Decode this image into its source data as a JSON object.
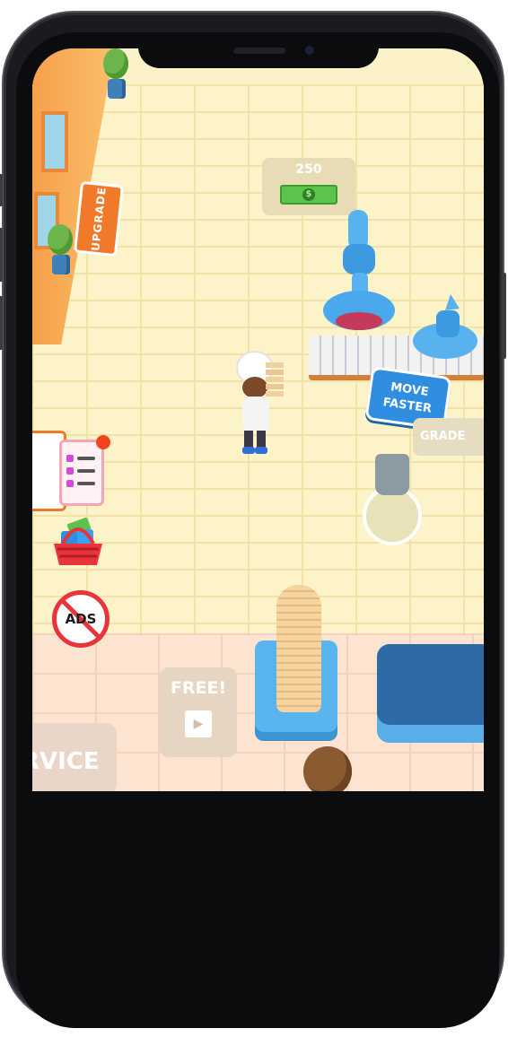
{
  "game": {
    "price_tag": {
      "amount": "250",
      "currency_icon": "dollar-bill-icon"
    },
    "upgrade_sign": "UPGRADE",
    "move_faster_badge": {
      "line1": "MOVE",
      "line2": "FASTER"
    },
    "upgrade_tag_partial": "GRADE",
    "free_tile": {
      "label": "FREE!",
      "icon": "video-ad-icon"
    },
    "service_tile": {
      "label": "RVICE"
    },
    "no_ads": {
      "label": "ADS"
    }
  },
  "colors": {
    "floor": "#fcf2c7",
    "wall": "#f7a04a",
    "accent_blue": "#2f8ee0",
    "cash_green": "#5cc44a",
    "no_ads_red": "#e8343a"
  }
}
